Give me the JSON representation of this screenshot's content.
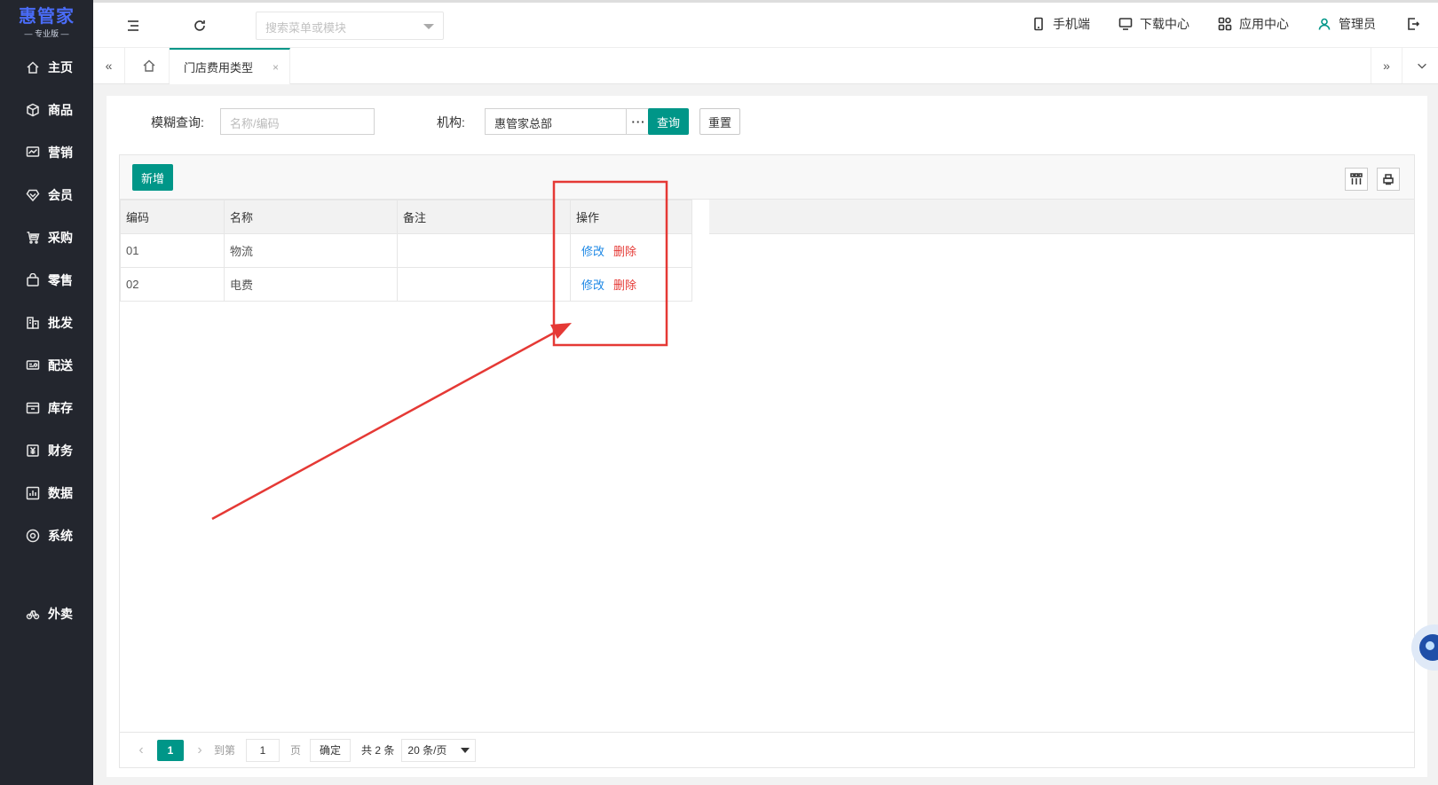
{
  "app": {
    "logo_main": "惠管家",
    "logo_sub": "— 专业版 —"
  },
  "sidebar": {
    "items": [
      {
        "label": "主页",
        "icon": "home-icon"
      },
      {
        "label": "商品",
        "icon": "box-icon"
      },
      {
        "label": "营销",
        "icon": "chart-icon"
      },
      {
        "label": "会员",
        "icon": "diamond-icon"
      },
      {
        "label": "采购",
        "icon": "cart-icon"
      },
      {
        "label": "零售",
        "icon": "bag-icon"
      },
      {
        "label": "批发",
        "icon": "building-icon"
      },
      {
        "label": "配送",
        "icon": "delivery-icon"
      },
      {
        "label": "库存",
        "icon": "inventory-icon"
      },
      {
        "label": "财务",
        "icon": "finance-icon"
      },
      {
        "label": "数据",
        "icon": "data-icon"
      },
      {
        "label": "系统",
        "icon": "settings-icon"
      },
      {
        "label": "外卖",
        "icon": "bike-icon"
      }
    ]
  },
  "topbar": {
    "search_placeholder": "搜索菜单或模块",
    "mobile": "手机端",
    "download": "下载中心",
    "apps": "应用中心",
    "user": "管理员"
  },
  "tabs": {
    "active": "门店费用类型",
    "close": "×"
  },
  "filter": {
    "fuzzy_label": "模糊查询:",
    "fuzzy_placeholder": "名称/编码",
    "org_label": "机构:",
    "org_value": "惠管家总部",
    "more": "···",
    "query": "查询",
    "reset": "重置"
  },
  "toolbar": {
    "add": "新增"
  },
  "table": {
    "headers": [
      "编码",
      "名称",
      "备注",
      "操作"
    ],
    "rows": [
      {
        "code": "01",
        "name": "物流",
        "remark": "",
        "edit": "修改",
        "delete": "删除"
      },
      {
        "code": "02",
        "name": "电费",
        "remark": "",
        "edit": "修改",
        "delete": "删除"
      }
    ]
  },
  "pager": {
    "current": "1",
    "goto_prefix": "到第",
    "goto_value": "1",
    "goto_suffix": "页",
    "confirm": "确定",
    "total": "共 2 条",
    "page_size": "20 条/页"
  },
  "annotation": {
    "color": "#e53935"
  }
}
